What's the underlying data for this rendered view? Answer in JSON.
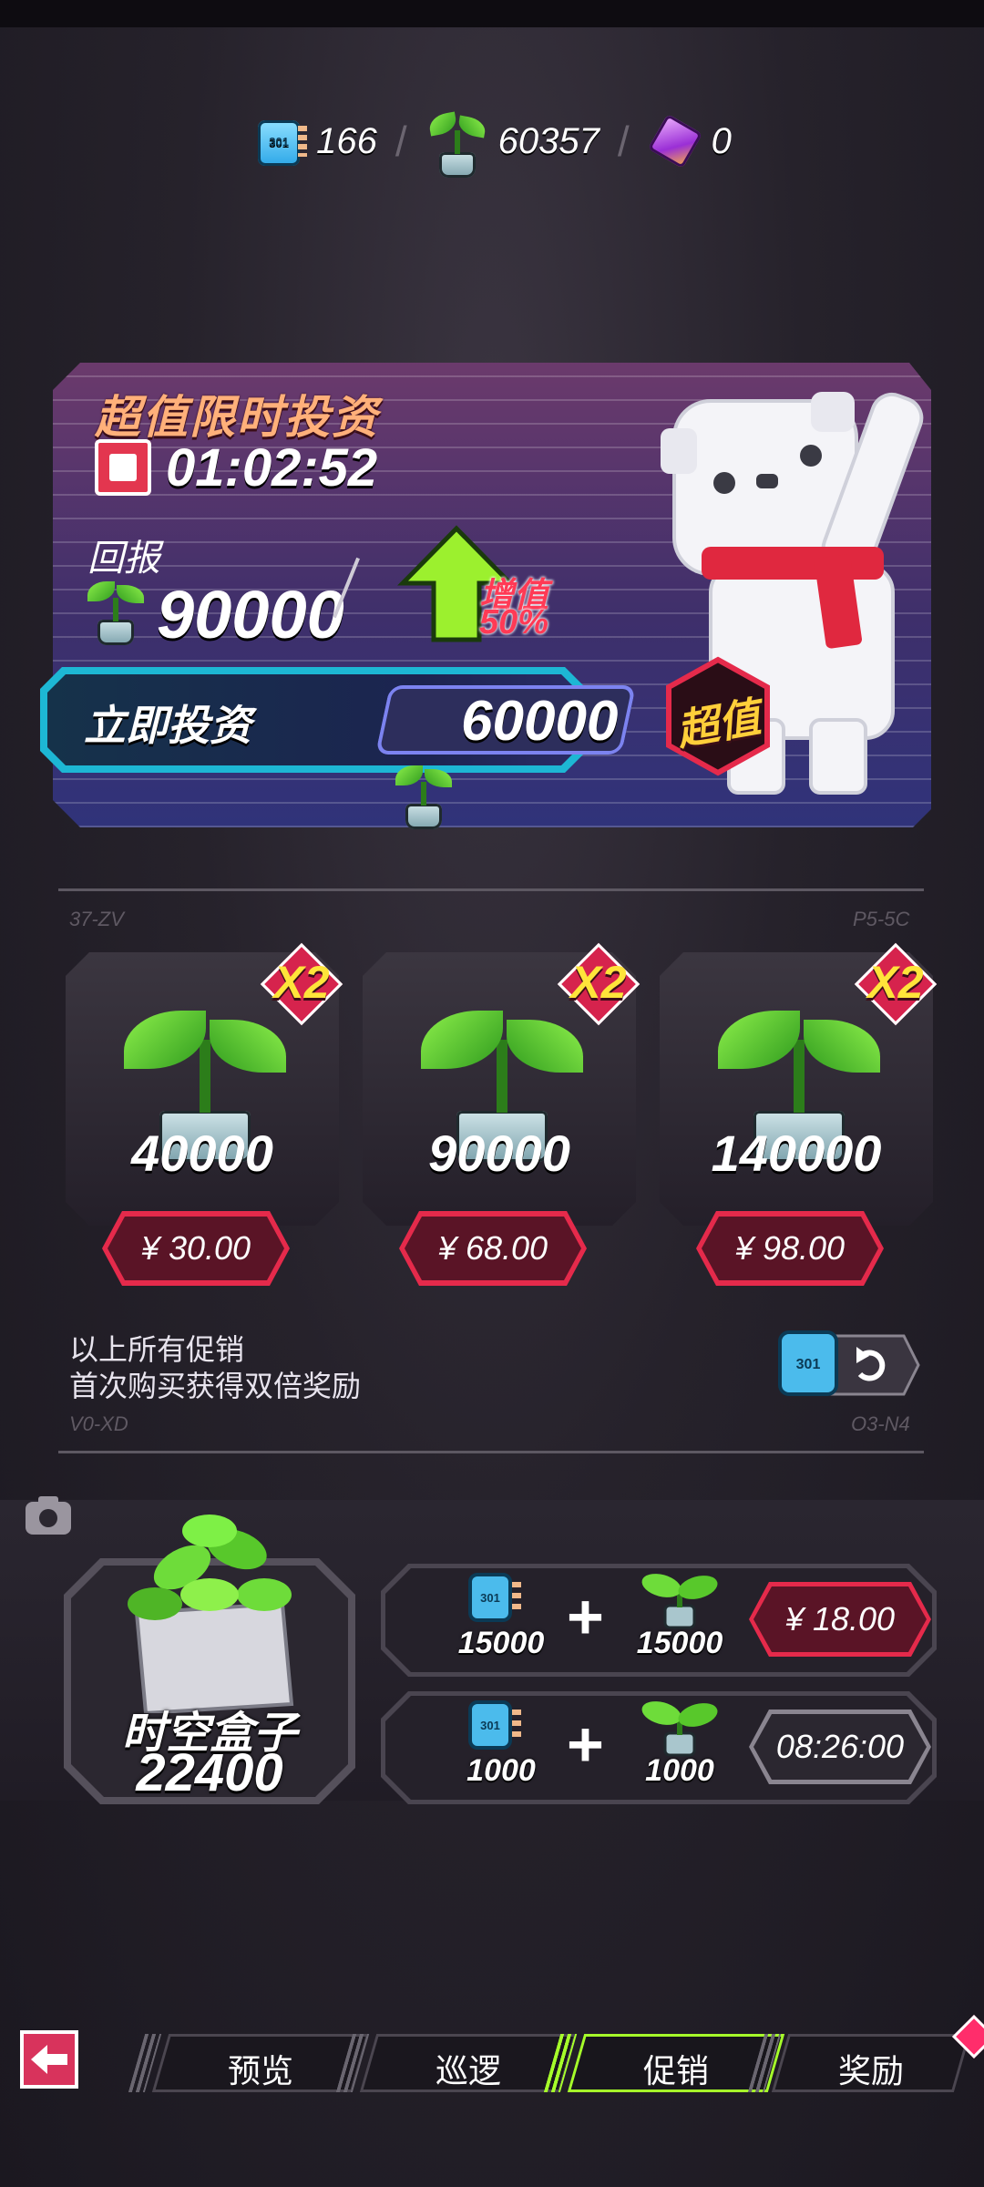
{
  "currencies": {
    "chip_icon_label": "301",
    "chip_value": "166",
    "sprout_value": "60357",
    "cube_value": "0"
  },
  "investment": {
    "title": "超值限时投资",
    "timer": "01:02:52",
    "reward_label": "回报",
    "reward_amount": "90000",
    "bonus_word": "增值",
    "bonus_percent": "50%",
    "invest_label": "立即投资",
    "invest_price": "60000",
    "badge": "超值"
  },
  "codes": {
    "top_left": "37-ZV",
    "top_right": "P5-5C",
    "bottom_left": "V0-XD",
    "bottom_right": "O3-N4"
  },
  "packs": [
    {
      "multiplier": "X2",
      "amount": "40000",
      "price": "¥ 30.00"
    },
    {
      "multiplier": "X2",
      "amount": "90000",
      "price": "¥ 68.00"
    },
    {
      "multiplier": "X2",
      "amount": "140000",
      "price": "¥ 98.00"
    }
  ],
  "promo_note": {
    "line1": "以上所有促销",
    "line2": "首次购买获得双倍奖励"
  },
  "bundle": {
    "box_name": "时空盒子",
    "box_amount": "22400",
    "rows": [
      {
        "chip_amount": "15000",
        "sprout_amount": "15000",
        "action": "¥ 18.00"
      },
      {
        "chip_amount": "1000",
        "sprout_amount": "1000",
        "action": "08:26:00"
      }
    ]
  },
  "nav": {
    "tabs": [
      "预览",
      "巡逻",
      "促销",
      "奖励"
    ],
    "active_tab": "促销"
  },
  "colors": {
    "accent_green": "#a6ff2a",
    "price_red": "#e52a4b",
    "cyan": "#1db7d4"
  }
}
